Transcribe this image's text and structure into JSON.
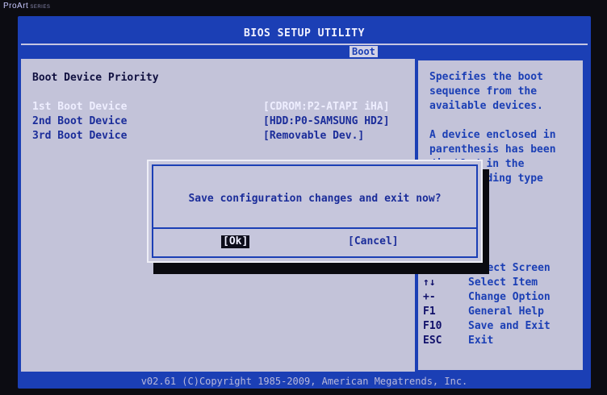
{
  "logo": {
    "brand": "ProArt",
    "tagline": "SERIES"
  },
  "header": {
    "title": "BIOS SETUP UTILITY",
    "active_tab": "Boot"
  },
  "main": {
    "heading": "Boot Device Priority",
    "rows": [
      {
        "label": "1st Boot Device",
        "value": "[CDROM:P2-ATAPI iHA]"
      },
      {
        "label": "2nd Boot Device",
        "value": "[HDD:P0-SAMSUNG HD2]"
      },
      {
        "label": "3rd Boot Device",
        "value": "[Removable Dev.]"
      }
    ]
  },
  "help": {
    "text": "Specifies the boot\nsequence from the\navailable devices.\n\nA device enclosed in\nparenthesis has been\ndisabled in the\ncorresponding type\nmenu."
  },
  "keys": [
    {
      "key": "←→",
      "desc": "Select Screen"
    },
    {
      "key": "↑↓",
      "desc": "Select Item"
    },
    {
      "key": "+-",
      "desc": "Change Option"
    },
    {
      "key": "F1",
      "desc": "General Help"
    },
    {
      "key": "F10",
      "desc": "Save and Exit"
    },
    {
      "key": "ESC",
      "desc": "Exit"
    }
  ],
  "footer": {
    "text": "v02.61 (C)Copyright 1985-2009, American Megatrends, Inc."
  },
  "dialog": {
    "message": "Save configuration changes and exit now?",
    "ok_label": "[Ok]",
    "cancel_label": "[Cancel]"
  }
}
